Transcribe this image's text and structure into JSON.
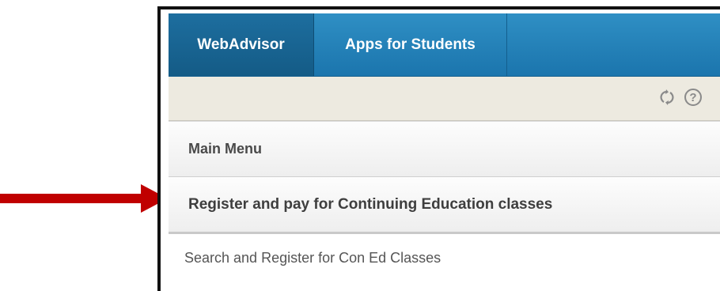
{
  "tabs": [
    {
      "label": "WebAdvisor",
      "active": true
    },
    {
      "label": "Apps for Students",
      "active": false
    }
  ],
  "toolbar": {
    "icons": [
      "refresh-icon",
      "help-icon"
    ],
    "help_glyph": "?"
  },
  "menu": {
    "main_menu_label": "Main Menu",
    "section_label": "Register and pay for Continuing Education classes",
    "items": [
      {
        "label": "Search and Register for Con Ed Classes"
      }
    ]
  },
  "colors": {
    "tab_bar": "#2f8fc4",
    "active_tab": "#1d6e9f",
    "toolbar_bg": "#edeae0",
    "annotation_arrow": "#c00000"
  }
}
